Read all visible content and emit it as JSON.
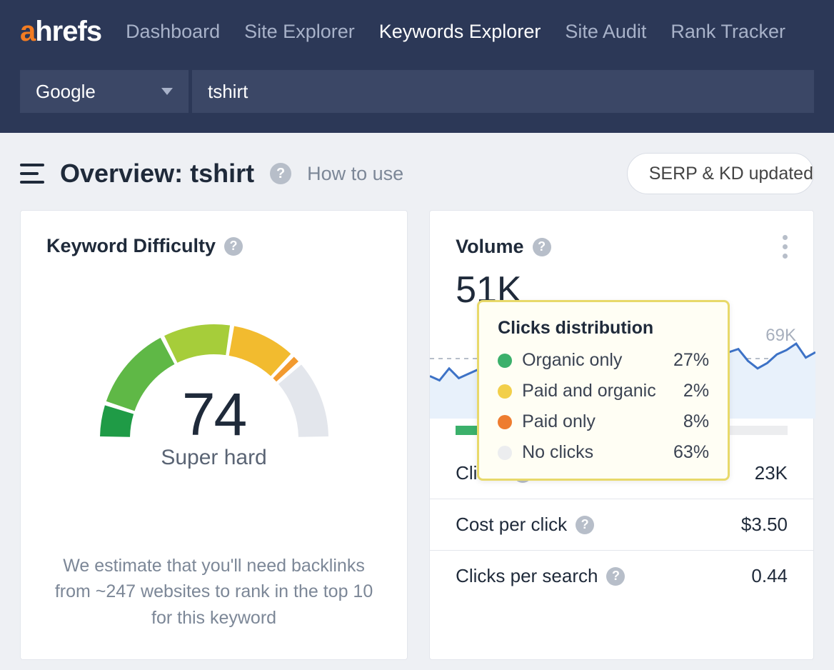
{
  "brand": {
    "a": "a",
    "rest": "hrefs"
  },
  "nav": {
    "dashboard": "Dashboard",
    "site_explorer": "Site Explorer",
    "keywords_explorer": "Keywords Explorer",
    "site_audit": "Site Audit",
    "rank_tracker": "Rank Tracker"
  },
  "search": {
    "engine": "Google",
    "keyword": "tshirt"
  },
  "overview": {
    "title": "Overview: tshirt",
    "how_to_use": "How to use",
    "serp_updated": "SERP & KD updated "
  },
  "kd": {
    "title": "Keyword Difficulty",
    "score": "74",
    "label": "Super hard",
    "note": "We estimate that you'll need backlinks from ~247 websites to rank in the top 10 for this keyword"
  },
  "volume": {
    "title": "Volume",
    "value": "51K",
    "spark_max": "69K",
    "clicks_label": "Clicks",
    "clicks_value": "23K",
    "cpc_label": "Cost per click",
    "cpc_value": "$3.50",
    "cps_label": "Clicks per search",
    "cps_value": "0.44"
  },
  "tooltip": {
    "title": "Clicks distribution",
    "rows": [
      {
        "label": "Organic only",
        "value": "27%",
        "color": "#3bb06b"
      },
      {
        "label": "Paid and organic",
        "value": "2%",
        "color": "#f2cf4a"
      },
      {
        "label": "Paid only",
        "value": "8%",
        "color": "#ee7c2f"
      },
      {
        "label": "No clicks",
        "value": "63%",
        "color": "#ecedef"
      }
    ]
  },
  "chart_data": {
    "gauge": {
      "type": "gauge",
      "value": 74,
      "range": [
        0,
        100
      ],
      "label": "Super hard",
      "segments": [
        {
          "from": 0,
          "to": 10,
          "color": "#1f9b46"
        },
        {
          "from": 10,
          "to": 35,
          "color": "#5fb846"
        },
        {
          "from": 35,
          "to": 55,
          "color": "#a6cd3a"
        },
        {
          "from": 55,
          "to": 74,
          "color": "#f2bb2f"
        },
        {
          "from": 74,
          "to": 77,
          "color": "#f29a2f"
        },
        {
          "from": 77,
          "to": 100,
          "color": "#e3e6ec"
        }
      ]
    },
    "sparkline": {
      "type": "line",
      "ylim": [
        0,
        69000
      ],
      "ymax_label": "69K",
      "values": [
        38000,
        34000,
        45000,
        36000,
        40000,
        44000,
        46000,
        44000,
        47000,
        50000,
        52000,
        53000,
        50000,
        47000,
        49000,
        48000,
        52000,
        58000,
        53000,
        47000,
        49000,
        50000,
        57000,
        55000,
        52000,
        49000,
        55000,
        59000,
        52000,
        49000,
        56000,
        60000,
        63000,
        52000,
        45000,
        50000,
        58000,
        62000,
        68000,
        55000,
        60000
      ]
    },
    "distribution": {
      "type": "bar",
      "title": "Clicks distribution",
      "categories": [
        "Organic only",
        "Paid and organic",
        "Paid only",
        "No clicks"
      ],
      "values": [
        27,
        2,
        8,
        63
      ],
      "colors": [
        "#3bb06b",
        "#f2cf4a",
        "#ee7c2f",
        "#ecedef"
      ]
    }
  }
}
